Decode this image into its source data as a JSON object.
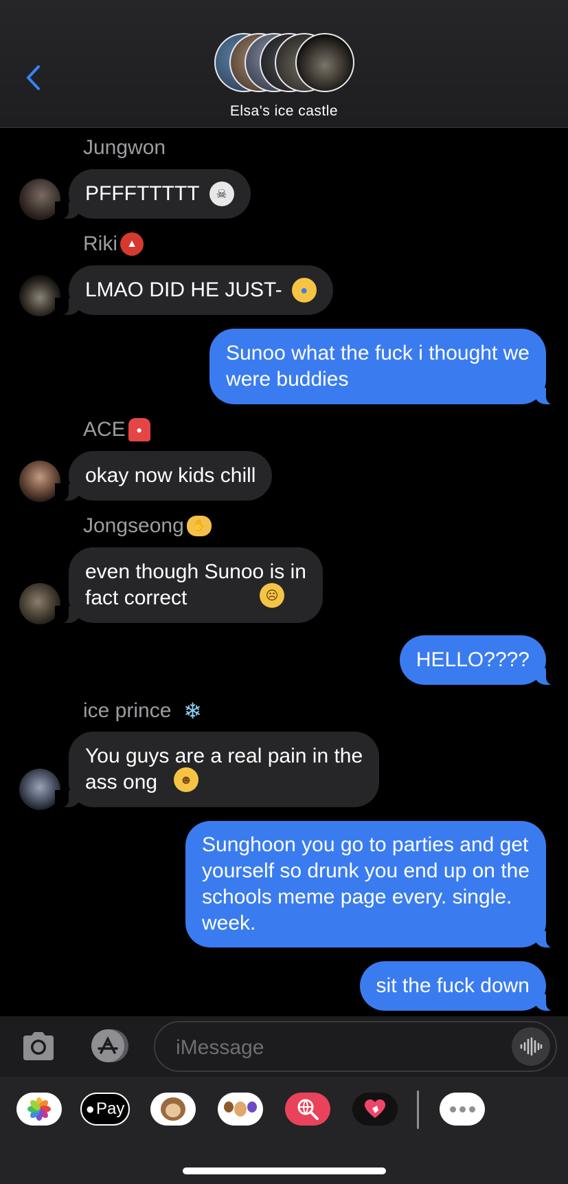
{
  "header": {
    "title": "Elsa's ice castle",
    "back_icon": "chevron-left-icon",
    "accent": "#3a82f7"
  },
  "messages": [
    {
      "sender": "Jungwon",
      "text": "PFFFTTTTT",
      "emoji": "skull-emoji",
      "direction": "incoming"
    },
    {
      "sender": "Riki",
      "sender_emoji": "ogre-emoji",
      "text": "LMAO DID HE JUST-",
      "emoji": "crying-face-emoji",
      "direction": "incoming"
    },
    {
      "text": "Sunoo what the fuck i thought we\nwere buddies",
      "direction": "outgoing"
    },
    {
      "sender": "ACE",
      "sender_emoji": "siren-emoji",
      "text": "okay now kids chill",
      "direction": "incoming"
    },
    {
      "sender": "Jongseong",
      "sender_emoji": "call-me-hand-emoji",
      "text": "even though Sunoo is in\nfact correct",
      "emoji": "worried-face-emoji",
      "direction": "incoming"
    },
    {
      "text": "HELLO????",
      "direction": "outgoing"
    },
    {
      "sender": "ice prince",
      "sender_emoji": "snowflake-emoji",
      "text": "You guys are a real pain in the\nass ong",
      "emoji": "cowboy-face-emoji",
      "direction": "incoming"
    },
    {
      "text": "Sunghoon you go to parties and get\nyourself so drunk you end up on the\nschools meme page every. single.\nweek.",
      "direction": "outgoing"
    },
    {
      "text": "sit the fuck down",
      "direction": "outgoing"
    }
  ],
  "input": {
    "placeholder": "iMessage",
    "camera_icon": "camera-icon",
    "apps_icon": "app-store-icon",
    "audio_icon": "audio-waveform-icon"
  },
  "app_drawer": [
    {
      "name": "photos-app-icon"
    },
    {
      "name": "apple-pay-app-icon",
      "label": "Pay"
    },
    {
      "name": "animoji-app-icon"
    },
    {
      "name": "memoji-stickers-app-icon"
    },
    {
      "name": "images-search-app-icon"
    },
    {
      "name": "digital-touch-app-icon"
    },
    {
      "name": "more-apps-icon"
    }
  ],
  "colors": {
    "outgoing_bubble": "#3a7cf0",
    "incoming_bubble": "#262628",
    "sender_name": "#9d9da2",
    "background": "#000000"
  }
}
